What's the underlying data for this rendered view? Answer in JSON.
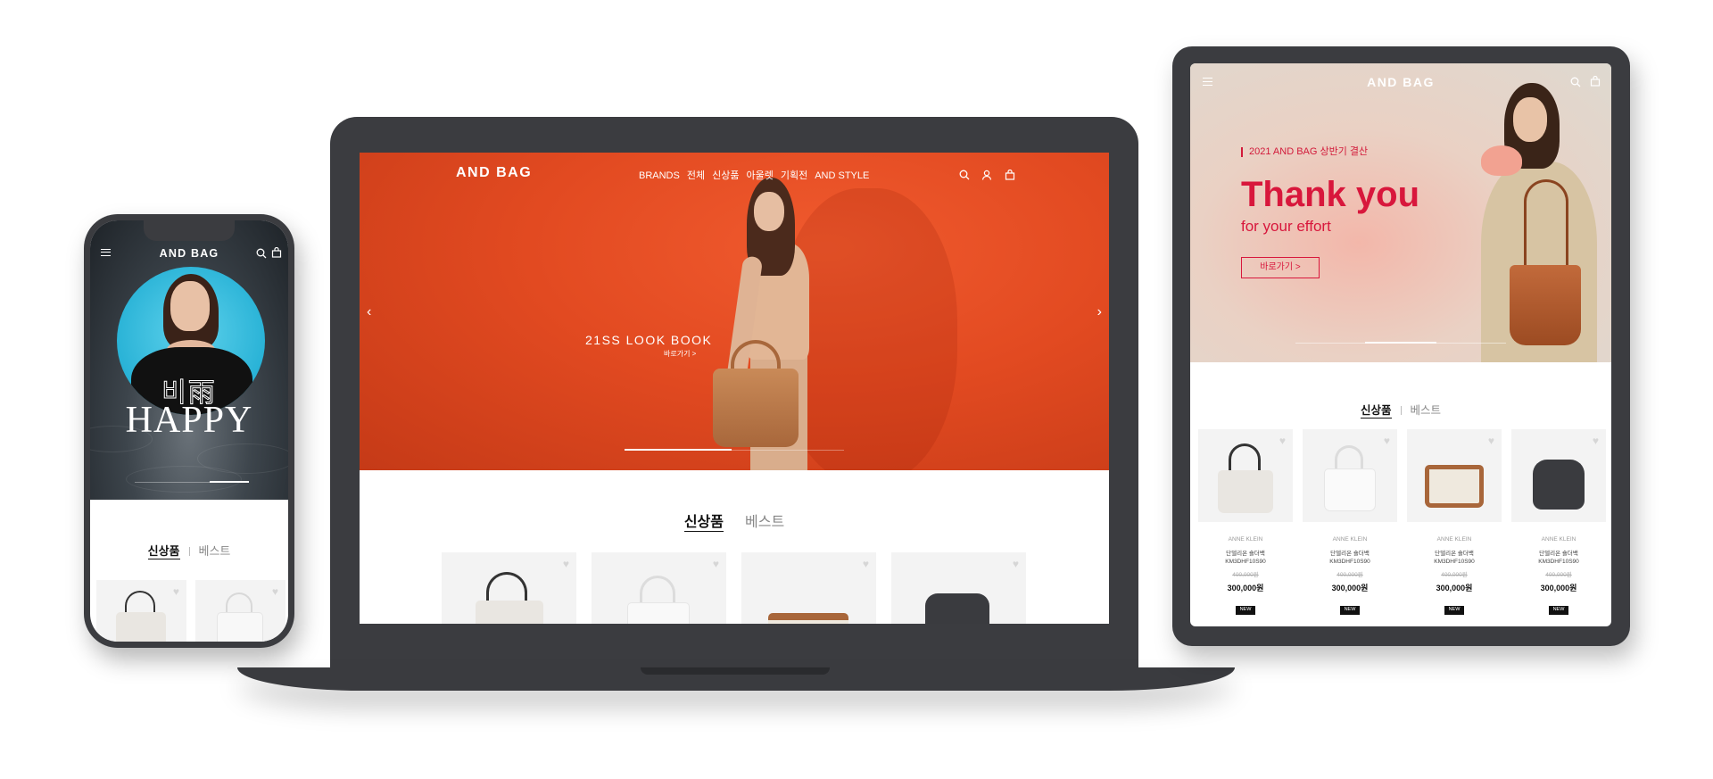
{
  "brand": "AND BAG",
  "laptop": {
    "nav": [
      "BRANDS",
      "전체",
      "신상품",
      "아울렛",
      "기획전",
      "AND STYLE"
    ],
    "hero_title": "21SS LOOK BOOK",
    "hero_link": "바로가기 >",
    "prev_arrow": "‹",
    "next_arrow": "›",
    "tab_new": "신상품",
    "tab_best": "베스트"
  },
  "phone": {
    "hero_hanja": "비雨",
    "hero_title": "HAPPY",
    "tab_new": "신상품",
    "tab_best": "베스트"
  },
  "tablet": {
    "hero_tag": "2021 AND BAG 상반기 결산",
    "hero_title": "Thank you",
    "hero_sub": "for your effort",
    "hero_button": "바로가기  >",
    "tab_new": "신상품",
    "tab_best": "베스트",
    "products": [
      {
        "brand": "ANNE KLEIN",
        "name": "단델리온 숄더백",
        "code": "KM3DHF10S90",
        "orig_price": "400,000원",
        "price": "300,000원",
        "badge": "NEW"
      },
      {
        "brand": "ANNE KLEIN",
        "name": "단델리온 숄더백",
        "code": "KM3DHF10S90",
        "orig_price": "400,000원",
        "price": "300,000원",
        "badge": "NEW"
      },
      {
        "brand": "ANNE KLEIN",
        "name": "단델리온 숄더백",
        "code": "KM3DHF10S90",
        "orig_price": "400,000원",
        "price": "300,000원",
        "badge": "NEW"
      },
      {
        "brand": "ANNE KLEIN",
        "name": "단델리온 숄더백",
        "code": "KM3DHF10S90",
        "orig_price": "400,000원",
        "price": "300,000원",
        "badge": "NEW"
      }
    ]
  },
  "colors": {
    "accent_red": "#d8173c",
    "hero_orange": "#e24a21",
    "device_frame": "#3b3c40"
  }
}
